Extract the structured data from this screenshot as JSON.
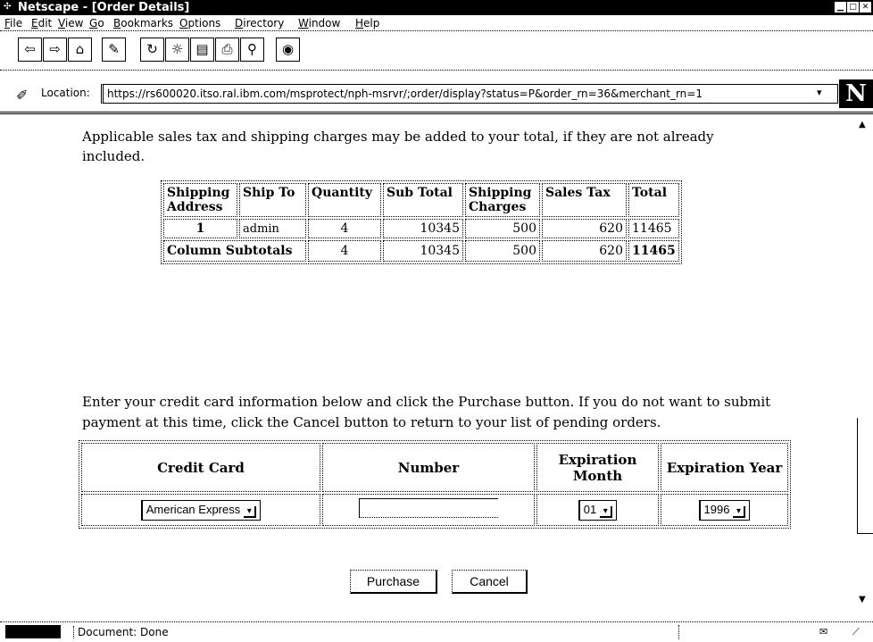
{
  "window": {
    "title": "Netscape - [Order Details]"
  },
  "menu": [
    "File",
    "Edit",
    "View",
    "Go",
    "Bookmarks",
    "Options",
    "Directory",
    "Window",
    "Help"
  ],
  "toolbar": {
    "icons": [
      "back-icon",
      "forward-icon",
      "home-icon",
      "edit-icon",
      "reload-icon",
      "images-icon",
      "open-icon",
      "print-icon",
      "find-icon",
      "stop-icon"
    ]
  },
  "location": {
    "label": "Location:",
    "url": "https://rs600020.itso.ral.ibm.com/msprotect/nph-msrvr/;order/display?status=P&order_rn=36&merchant_rn=1"
  },
  "intro_text": "Applicable sales tax and shipping charges may be added to your total, if they are not already included.",
  "order_table": {
    "headers": [
      "Shipping Address",
      "Ship To",
      "Quantity",
      "Sub Total",
      "Shipping Charges",
      "Sales Tax",
      "Total"
    ],
    "row": [
      "1",
      "admin",
      "4",
      "10345",
      "500",
      "620",
      "11465"
    ],
    "subtotal_label": "Column Subtotals",
    "subtotals": [
      "4",
      "10345",
      "500",
      "620",
      "11465"
    ]
  },
  "instructions": "Enter your credit card information below and click the Purchase button. If you do not want to submit payment at this time, click the Cancel button to return to your list of pending orders.",
  "cc_table": {
    "headers": [
      "Credit Card",
      "Number",
      "Expiration Month",
      "Expiration Year"
    ],
    "card_type": "American Express",
    "number_value": "",
    "exp_month": "01",
    "exp_year": "1996"
  },
  "buttons": {
    "purchase": "Purchase",
    "cancel": "Cancel"
  },
  "status": {
    "text": "Document: Done"
  }
}
